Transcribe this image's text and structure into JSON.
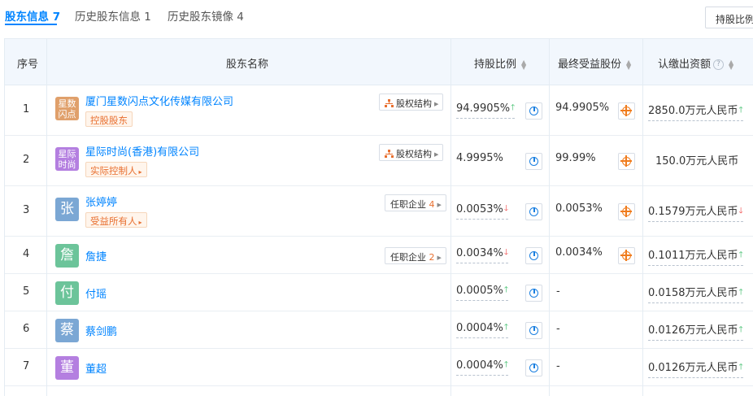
{
  "tabs": [
    {
      "label": "股东信息",
      "count": "7"
    },
    {
      "label": "历史股东信息",
      "count": "1"
    },
    {
      "label": "历史股东镜像",
      "count": "4"
    }
  ],
  "hold_ratio_button": "持股比例",
  "columns": {
    "index": "序号",
    "name": "股东名称",
    "ratio": "持股比例",
    "final": "最终受益股份",
    "capital": "认缴出资额",
    "help": "?"
  },
  "rows": [
    {
      "index": "1",
      "logo_text": "星数闪点",
      "logo_color": "#e0a06b",
      "name": "厦门星数闪点文化传媒有限公司",
      "tag": "控股股东",
      "tag_arrow": false,
      "side": "股权结构",
      "side_count": "",
      "ratio": "94.9905%",
      "ratio_trend": "up",
      "final": "94.9905%",
      "capital": "2850.0万元人民币",
      "capital_trend": "up"
    },
    {
      "index": "2",
      "logo_text": "星际时尚",
      "logo_color": "#b47fe0",
      "name": "星际时尚(香港)有限公司",
      "tag": "实际控制人",
      "tag_arrow": true,
      "side": "股权结构",
      "side_count": "",
      "ratio": "4.9995%",
      "ratio_trend": "",
      "final": "99.99%",
      "capital": "150.0万元人民币",
      "capital_trend": ""
    },
    {
      "index": "3",
      "logo_text": "张",
      "logo_color": "#7ba7d4",
      "name": "张婷婷",
      "tag": "受益所有人",
      "tag_arrow": true,
      "side": "任职企业",
      "side_count": "4",
      "ratio": "0.0053%",
      "ratio_trend": "down",
      "final": "0.0053%",
      "capital": "0.1579万元人民币",
      "capital_trend": "down"
    },
    {
      "index": "4",
      "logo_text": "詹",
      "logo_color": "#6cc49a",
      "name": "詹捷",
      "tag": "",
      "tag_arrow": false,
      "side": "任职企业",
      "side_count": "2",
      "ratio": "0.0034%",
      "ratio_trend": "down",
      "final": "0.0034%",
      "capital": "0.1011万元人民币",
      "capital_trend": "up"
    },
    {
      "index": "5",
      "logo_text": "付",
      "logo_color": "#6cc49a",
      "name": "付瑶",
      "tag": "",
      "tag_arrow": false,
      "side": "",
      "side_count": "",
      "ratio": "0.0005%",
      "ratio_trend": "up",
      "final": "-",
      "capital": "0.0158万元人民币",
      "capital_trend": "up"
    },
    {
      "index": "6",
      "logo_text": "蔡",
      "logo_color": "#7ba7d4",
      "name": "蔡剑鹏",
      "tag": "",
      "tag_arrow": false,
      "side": "",
      "side_count": "",
      "ratio": "0.0004%",
      "ratio_trend": "up",
      "final": "-",
      "capital": "0.0126万元人民币",
      "capital_trend": "up"
    },
    {
      "index": "7",
      "logo_text": "董",
      "logo_color": "#b47fe0",
      "name": "董超",
      "tag": "",
      "tag_arrow": false,
      "side": "",
      "side_count": "",
      "ratio": "0.0004%",
      "ratio_trend": "up",
      "final": "-",
      "capital": "0.0126万元人民币",
      "capital_trend": "up"
    }
  ]
}
